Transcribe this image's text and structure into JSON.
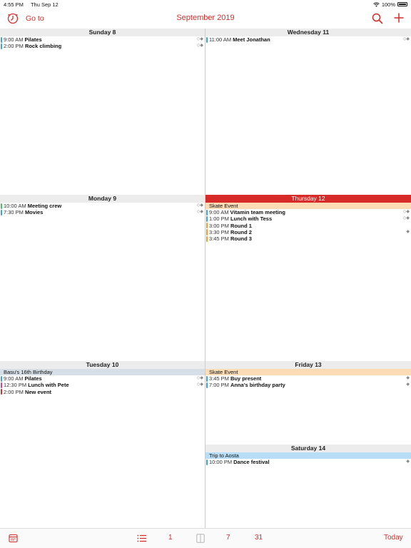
{
  "status_bar": {
    "time": "4:55 PM",
    "date": "Thu Sep 12",
    "battery": "100%",
    "icons": [
      "wifi-icon",
      "battery-icon"
    ]
  },
  "nav": {
    "goto_label": "Go to",
    "title": "September 2019",
    "icons": [
      "goto-clock-icon",
      "search-icon",
      "plus-icon"
    ]
  },
  "colors": {
    "accent": "#d62b28",
    "today_header": "#d62b28",
    "skate_event_bg": "#fcdcb4",
    "birthday_bg": "#d6dfe7",
    "trip_bg": "#b7def6",
    "bar_blue": "#3aa0e7",
    "bar_orange": "#f39a2a",
    "bar_green": "#47c45a",
    "bar_red": "#d62b28",
    "bar_magenta": "#d83a8c"
  },
  "days": [
    {
      "title": "Sunday 8",
      "allday": [],
      "events": [
        {
          "time": "9:00 AM",
          "name": "Pilates",
          "color": "#3aa0e7",
          "indicator": "◇◆"
        },
        {
          "time": "2:00 PM",
          "name": "Rock climbing",
          "color": "#3aa0e7",
          "indicator": "◇◆"
        }
      ]
    },
    {
      "title": "Wednesday 11",
      "allday": [],
      "events": [
        {
          "time": "11:00 AM",
          "name": "Meet Jonathan",
          "color": "#3aa0e7",
          "indicator": "◇◆"
        }
      ]
    },
    {
      "title": "Monday 9",
      "allday": [],
      "events": [
        {
          "time": "10:00 AM",
          "name": "Meeting crew",
          "color": "#47c45a",
          "indicator": "◇◆"
        },
        {
          "time": "7:30 PM",
          "name": "Movies",
          "color": "#3aa0e7",
          "indicator": "◇◆"
        }
      ]
    },
    {
      "title": "Thursday 12",
      "today": true,
      "allday": [
        {
          "name": "Skate Event",
          "bg": "#fcdcb4"
        }
      ],
      "events": [
        {
          "time": "9:00 AM",
          "name": "Vitamin team meeting",
          "color": "#3aa0e7",
          "indicator": "◇◆"
        },
        {
          "time": "1:00 PM",
          "name": "Lunch with Tess",
          "color": "#3aa0e7",
          "indicator": "◇◆"
        },
        {
          "time": "3:00 PM",
          "name": "Round 1",
          "color": "#f39a2a",
          "indicator": ""
        },
        {
          "time": "3:30 PM",
          "name": "Round 2",
          "color": "#f39a2a",
          "indicator": "◆"
        },
        {
          "time": "3:45 PM",
          "name": "Round 3",
          "color": "#f39a2a",
          "indicator": ""
        }
      ]
    },
    {
      "title": "Tuesday 10",
      "allday": [
        {
          "name": "Basu's 16th Birthday",
          "bg": "#d6dfe7"
        }
      ],
      "events": [
        {
          "time": "9:00 AM",
          "name": "Pilates",
          "color": "#3aa0e7",
          "indicator": "◇◆"
        },
        {
          "time": "12:30 PM",
          "name": "Lunch with Pete",
          "color": "#d83a8c",
          "indicator": "◇◆"
        },
        {
          "time": "2:00 PM",
          "name": "New event",
          "color": "#d62b28",
          "indicator": ""
        }
      ]
    },
    {
      "title": "Friday 13",
      "allday": [
        {
          "name": "Skate Event",
          "bg": "#fcdcb4"
        }
      ],
      "events": [
        {
          "time": "3:45 PM",
          "name": "Buy present",
          "color": "#3aa0e7",
          "indicator": "◆"
        },
        {
          "time": "7:00 PM",
          "name": "Anna's birthday party",
          "color": "#3aa0e7",
          "indicator": "◆"
        }
      ]
    },
    {
      "title": "Saturday 14",
      "allday": [
        {
          "name": "Trip to Aosta",
          "bg": "#b7def6"
        }
      ],
      "events": [
        {
          "time": "10:00 PM",
          "name": "Dance festival",
          "color": "#3aa0e7",
          "indicator": "◆"
        }
      ]
    }
  ],
  "tabbar": {
    "list_view": "",
    "day_view": "1",
    "week_view": "7",
    "month_view": "31",
    "today": "Today",
    "icons": [
      "calendars-icon",
      "list-icon",
      "split-view-icon"
    ]
  }
}
